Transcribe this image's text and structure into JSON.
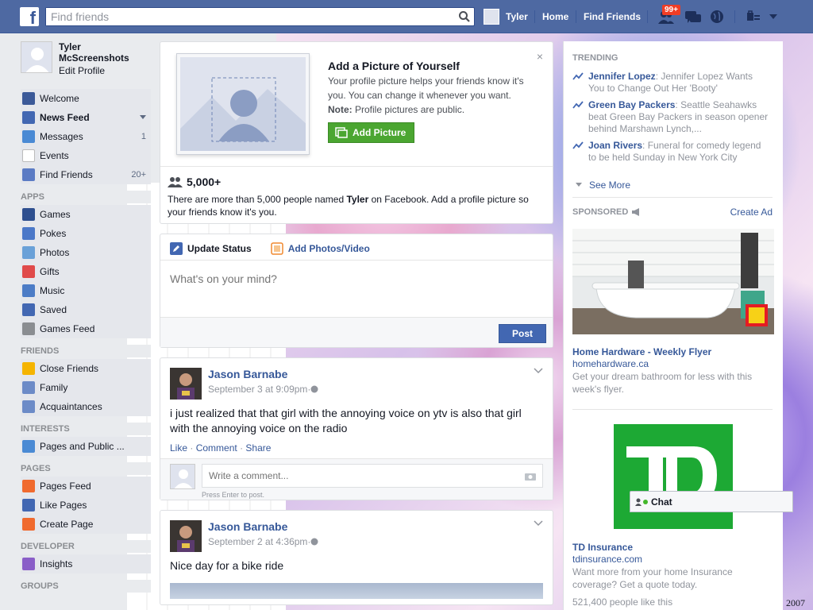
{
  "topbar": {
    "logo": "f",
    "search_placeholder": "Find friends",
    "user_name": "Tyler",
    "home": "Home",
    "find_friends": "Find Friends",
    "notif_badge": "99+"
  },
  "profile": {
    "name": "Tyler McScreenshots",
    "edit": "Edit Profile"
  },
  "nav": {
    "main": [
      {
        "label": "Welcome",
        "color": "#3b5998"
      },
      {
        "label": "News Feed",
        "color": "#4267b2"
      },
      {
        "label": "Messages",
        "count": "1",
        "color": "#4a8ad4"
      },
      {
        "label": "Events",
        "color": "#ffffff"
      },
      {
        "label": "Find Friends",
        "count": "20+",
        "color": "#5b7bc4"
      }
    ],
    "apps_head": "APPS",
    "apps": [
      {
        "label": "Games",
        "color": "#2e4f8f"
      },
      {
        "label": "Pokes",
        "color": "#4b78c8"
      },
      {
        "label": "Photos",
        "color": "#6aa1d8"
      },
      {
        "label": "Gifts",
        "color": "#e04a4a"
      },
      {
        "label": "Music",
        "color": "#4c7cc6"
      },
      {
        "label": "Saved",
        "color": "#4267b2"
      },
      {
        "label": "Games Feed",
        "color": "#8a8d91"
      }
    ],
    "friends_head": "FRIENDS",
    "friends": [
      {
        "label": "Close Friends",
        "color": "#f5b400"
      },
      {
        "label": "Family",
        "color": "#6c8bc7"
      },
      {
        "label": "Acquaintances",
        "color": "#6c8bc7"
      }
    ],
    "interests_head": "INTERESTS",
    "interests": [
      {
        "label": "Pages and Public ...",
        "color": "#4a8ad4"
      }
    ],
    "pages_head": "PAGES",
    "pages": [
      {
        "label": "Pages Feed",
        "color": "#f06a2e"
      },
      {
        "label": "Like Pages",
        "color": "#4267b2"
      },
      {
        "label": "Create Page",
        "color": "#f06a2e"
      }
    ],
    "developer_head": "DEVELOPER",
    "developer": [
      {
        "label": "Insights",
        "color": "#8a5ec8"
      }
    ],
    "groups_head": "GROUPS"
  },
  "pic_card": {
    "title": "Add a Picture of Yourself",
    "desc": "Your profile picture helps your friends know it's you. You can change it whenever you want.",
    "note_label": "Note:",
    "note": " Profile pictures are public.",
    "button": "Add Picture",
    "close": "×",
    "count": "5,000+",
    "people_desc_1": "There are more than 5,000 people named ",
    "people_name": "Tyler",
    "people_desc_2": " on Facebook. Add a profile picture so your friends know it's you."
  },
  "status": {
    "tab_update": "Update Status",
    "tab_photos": "Add Photos/Video",
    "placeholder": "What's on your mind?",
    "post": "Post"
  },
  "posts": [
    {
      "author": "Jason Barnabe",
      "time": "September 3 at 9:09pm",
      "sep": " · ",
      "text": "i just realized that that girl with the annoying voice on ytv is also that girl with the annoying voice on the radio",
      "like": "Like",
      "comment": "Comment",
      "share": "Share",
      "comment_placeholder": "Write a comment...",
      "comment_hint": "Press Enter to post."
    },
    {
      "author": "Jason Barnabe",
      "time": "September 2 at 4:36pm",
      "sep": " · ",
      "text": "Nice day for a bike ride"
    }
  ],
  "right": {
    "trending_head": "TRENDING",
    "trending": [
      {
        "topic": "Jennifer Lopez",
        "text": ": Jennifer Lopez Wants You to Change Out Her 'Booty'"
      },
      {
        "topic": "Green Bay Packers",
        "text": ": Seattle Seahawks beat Green Bay Packers in season opener behind Marshawn Lynch,..."
      },
      {
        "topic": "Joan Rivers",
        "text": ": Funeral for comedy legend to be held Sunday in New York City"
      }
    ],
    "see_more": "See More",
    "sponsored": "SPONSORED",
    "create_ad": "Create Ad",
    "ads": [
      {
        "title": "Home Hardware - Weekly Flyer",
        "url": "homehardware.ca",
        "desc": "Get your dream bathroom for less with this week's flyer."
      },
      {
        "title": "TD Insurance",
        "url": "tdinsurance.com",
        "desc": "Want more from your home Insurance coverage? Get a quote today.",
        "likes": "521,400 people like this"
      }
    ],
    "td_logo_text": "TD"
  },
  "chat": {
    "label": "Chat"
  },
  "year_mark": "2007"
}
